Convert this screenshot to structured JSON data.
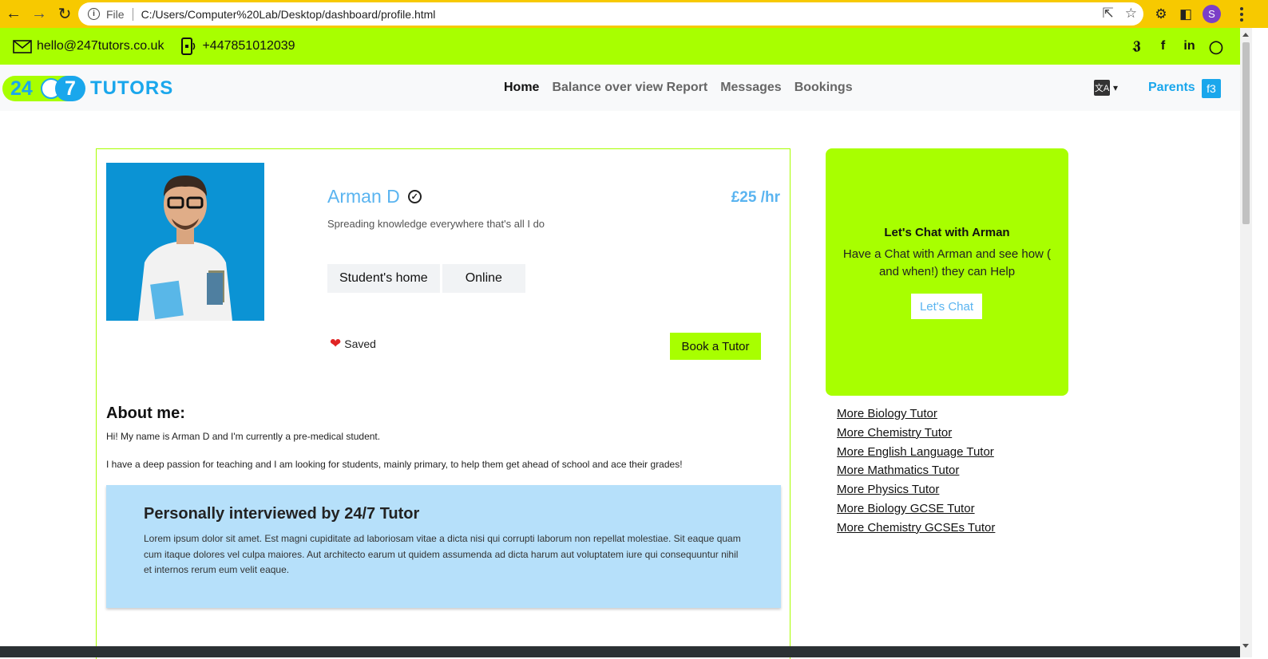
{
  "browser": {
    "file_label": "File",
    "url": "C:/Users/Computer%20Lab/Desktop/dashboard/profile.html",
    "profile_initial": "S"
  },
  "topbar": {
    "email": "hello@247tutors.co.uk",
    "phone": "+447851012039",
    "socials": [
      "twitter-icon",
      "facebook-icon",
      "linkedin-icon",
      "instagram-icon"
    ]
  },
  "nav": {
    "logo_24": "24",
    "logo_7": "7",
    "logo_word": "TUTORS",
    "links": [
      "Home",
      "Balance over view Report",
      "Messages",
      "Bookings"
    ],
    "active": "Home",
    "role": "Parents",
    "role_badge": "f3"
  },
  "profile": {
    "name": "Arman D",
    "tagline": "Spreading knowledge everywhere that's all I do",
    "price": "£25 /hr",
    "locations": [
      "Student's home",
      "Online"
    ],
    "saved_label": "Saved",
    "book_label": "Book a Tutor",
    "about_heading": "About me:",
    "about_p1": "Hi! My name is Arman D and I'm currently a pre-medical student.",
    "about_p2": "I have a deep passion for teaching and I am looking for students, mainly primary, to help them get ahead of school and ace their grades!",
    "interview_heading": "Personally interviewed by 24/7 Tutor",
    "interview_text": "Lorem ipsum dolor sit amet. Est magni cupiditate ad laboriosam vitae a dicta nisi qui corrupti laborum non repellat molestiae. Sit eaque quam cum itaque dolores vel culpa maiores. Aut architecto earum ut quidem assumenda ad dicta harum aut voluptatem iure qui consequuntur nihil et internos rerum eum velit eaque."
  },
  "chat": {
    "heading": "Let's Chat with Arman",
    "text": "Have a Chat with Arman and see how ( and when!) they can Help",
    "button": "Let's Chat"
  },
  "more_links": [
    "More Biology Tutor",
    "More Chemistry Tutor",
    "More English Language Tutor",
    "More Mathmatics Tutor",
    "More Physics Tutor",
    "More Biology GCSE Tutor",
    "More Chemistry GCSEs Tutor"
  ],
  "colors": {
    "accent_green": "#a8ff00",
    "accent_blue": "#1aa7ec",
    "chrome_yellow": "#f7c900",
    "interview_blue": "#b6e0fa"
  }
}
